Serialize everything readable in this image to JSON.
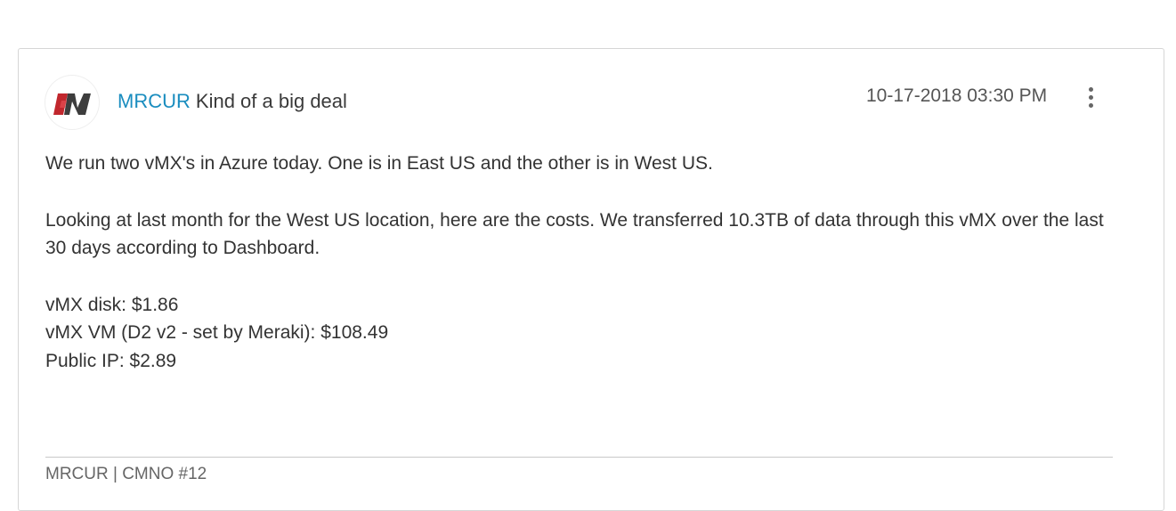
{
  "post": {
    "author": {
      "name": "MRCUR",
      "rank": "Kind of a big deal",
      "avatar_icon": "meraki-logo-avatar",
      "name_color": "#1a8dbf"
    },
    "date": "10-17-2018 03:30 PM",
    "menu_icon": "vertical-ellipsis-icon",
    "body": {
      "paragraph_1": "We run two vMX's in Azure today. One is in East US and the other is in West US.",
      "paragraph_2": "Looking at last month for the West US location, here are the costs. We transferred 10.3TB of data through this vMX over the last 30 days according to Dashboard.",
      "cost_lines": [
        "vMX disk: $1.86",
        "vMX VM (D2 v2 - set by Meraki): $108.49",
        "Public IP: $2.89"
      ]
    },
    "signature": "MRCUR | CMNO #12"
  }
}
